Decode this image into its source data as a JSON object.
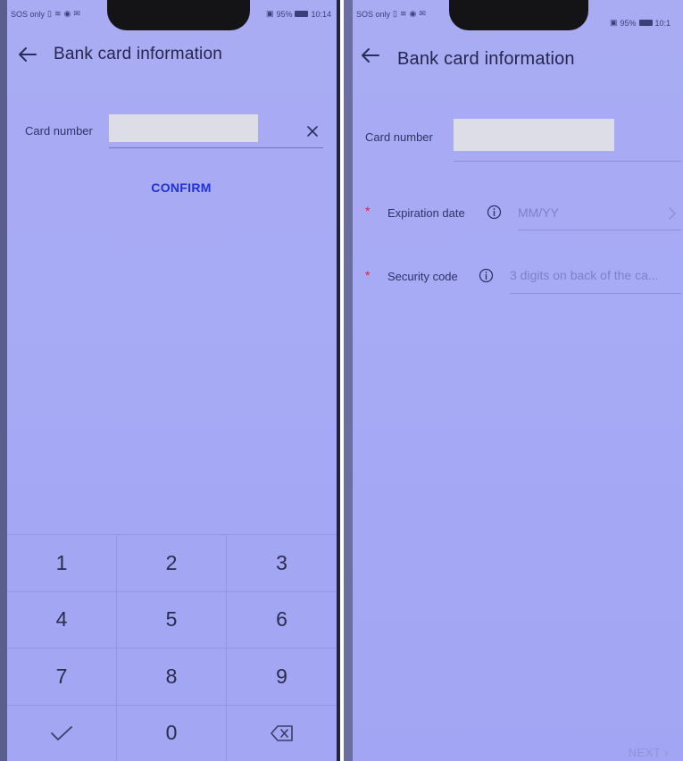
{
  "left_screen": {
    "status_left": "SOS only",
    "status_battery": "95%",
    "status_time": "10:14",
    "title": "Bank card information",
    "card_number_label": "Card number",
    "confirm_label": "CONFIRM",
    "keypad": [
      "1",
      "2",
      "3",
      "4",
      "5",
      "6",
      "7",
      "8",
      "9",
      "",
      "0",
      ""
    ]
  },
  "right_screen": {
    "status_left": "SOS only",
    "status_battery": "95%",
    "status_time": "10:1",
    "title": "Bank card information",
    "card_number_label": "Card number",
    "expiration_label": "Expiration date",
    "expiration_placeholder": "MM/YY",
    "security_label": "Security code",
    "security_placeholder": "3 digits on back of the ca...",
    "required_mark": "*",
    "next_label": "NEXT"
  },
  "icons": {
    "back": "back-arrow-icon",
    "clear": "close-icon",
    "info": "info-icon",
    "chevron": "chevron-right-icon",
    "confirm_key": "check-icon",
    "delete_key": "backspace-icon"
  },
  "colors": {
    "screen_bg": "#a7aaf4",
    "accent": "#1f32d6",
    "required": "#c72a35",
    "placeholder": "#7d82c6"
  }
}
